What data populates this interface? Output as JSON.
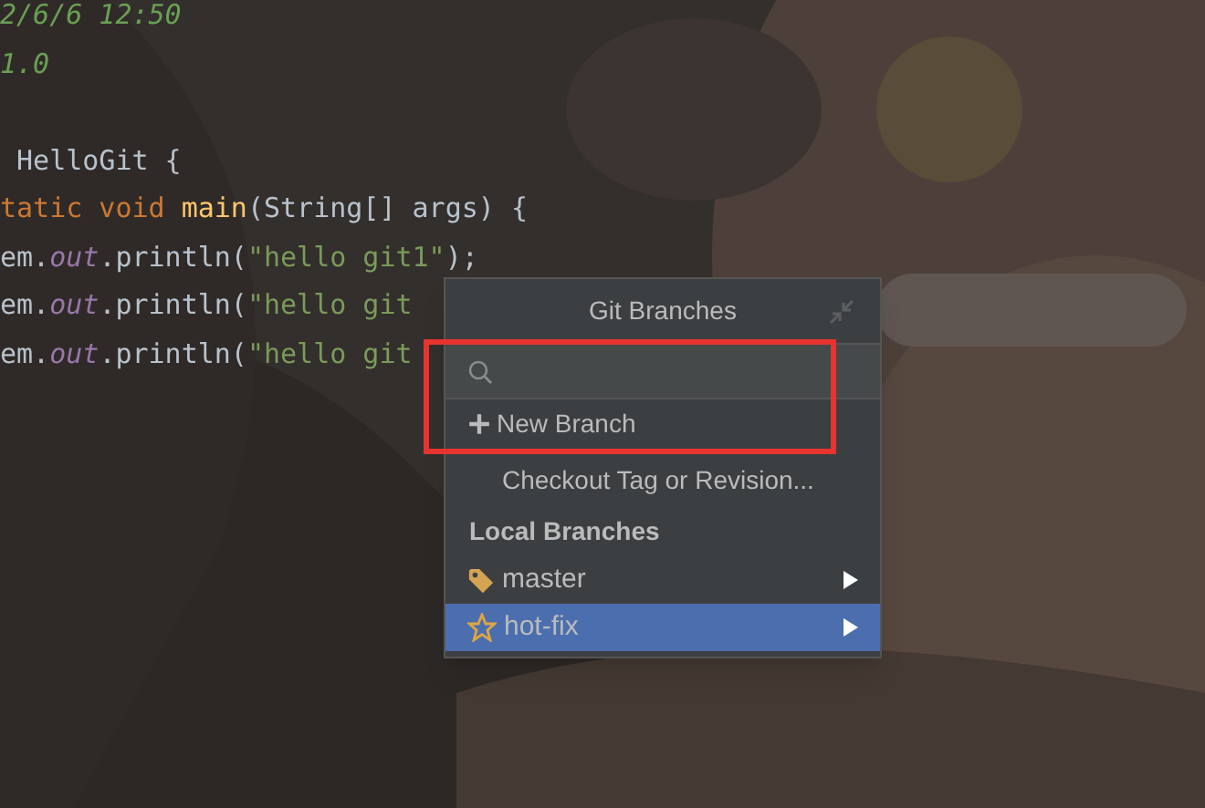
{
  "editor": {
    "lines": [
      [
        {
          "kind": "comment",
          "text": "2/6/6 12:50"
        }
      ],
      [
        {
          "kind": "comment",
          "text": "1.0"
        }
      ],
      [
        {
          "kind": "plain",
          "text": " HelloGit {"
        }
      ],
      [
        {
          "kind": "keyword",
          "text": "tatic void "
        },
        {
          "kind": "method",
          "text": "main"
        },
        {
          "kind": "plain",
          "text": "(String[] args) {"
        }
      ],
      [
        {
          "kind": "plain",
          "text": "em."
        },
        {
          "kind": "field",
          "text": "out"
        },
        {
          "kind": "plain",
          "text": ".println("
        },
        {
          "kind": "string",
          "text": "\"hello git1\""
        },
        {
          "kind": "plain",
          "text": ");"
        }
      ],
      [
        {
          "kind": "plain",
          "text": "em."
        },
        {
          "kind": "field",
          "text": "out"
        },
        {
          "kind": "plain",
          "text": ".println("
        },
        {
          "kind": "string",
          "text": "\"hello git"
        }
      ],
      [
        {
          "kind": "plain",
          "text": "em."
        },
        {
          "kind": "field",
          "text": "out"
        },
        {
          "kind": "plain",
          "text": ".println("
        },
        {
          "kind": "string",
          "text": "\"hello git"
        }
      ]
    ]
  },
  "popup": {
    "title": "Git Branches",
    "actions": [
      {
        "kind": "new",
        "label": "New Branch"
      },
      {
        "kind": "plain",
        "label": "Checkout Tag or Revision..."
      }
    ],
    "section": "Local Branches",
    "branches": [
      {
        "name": "master",
        "kind": "tag",
        "selected": false
      },
      {
        "name": "hot-fix",
        "kind": "star",
        "selected": true
      }
    ]
  }
}
